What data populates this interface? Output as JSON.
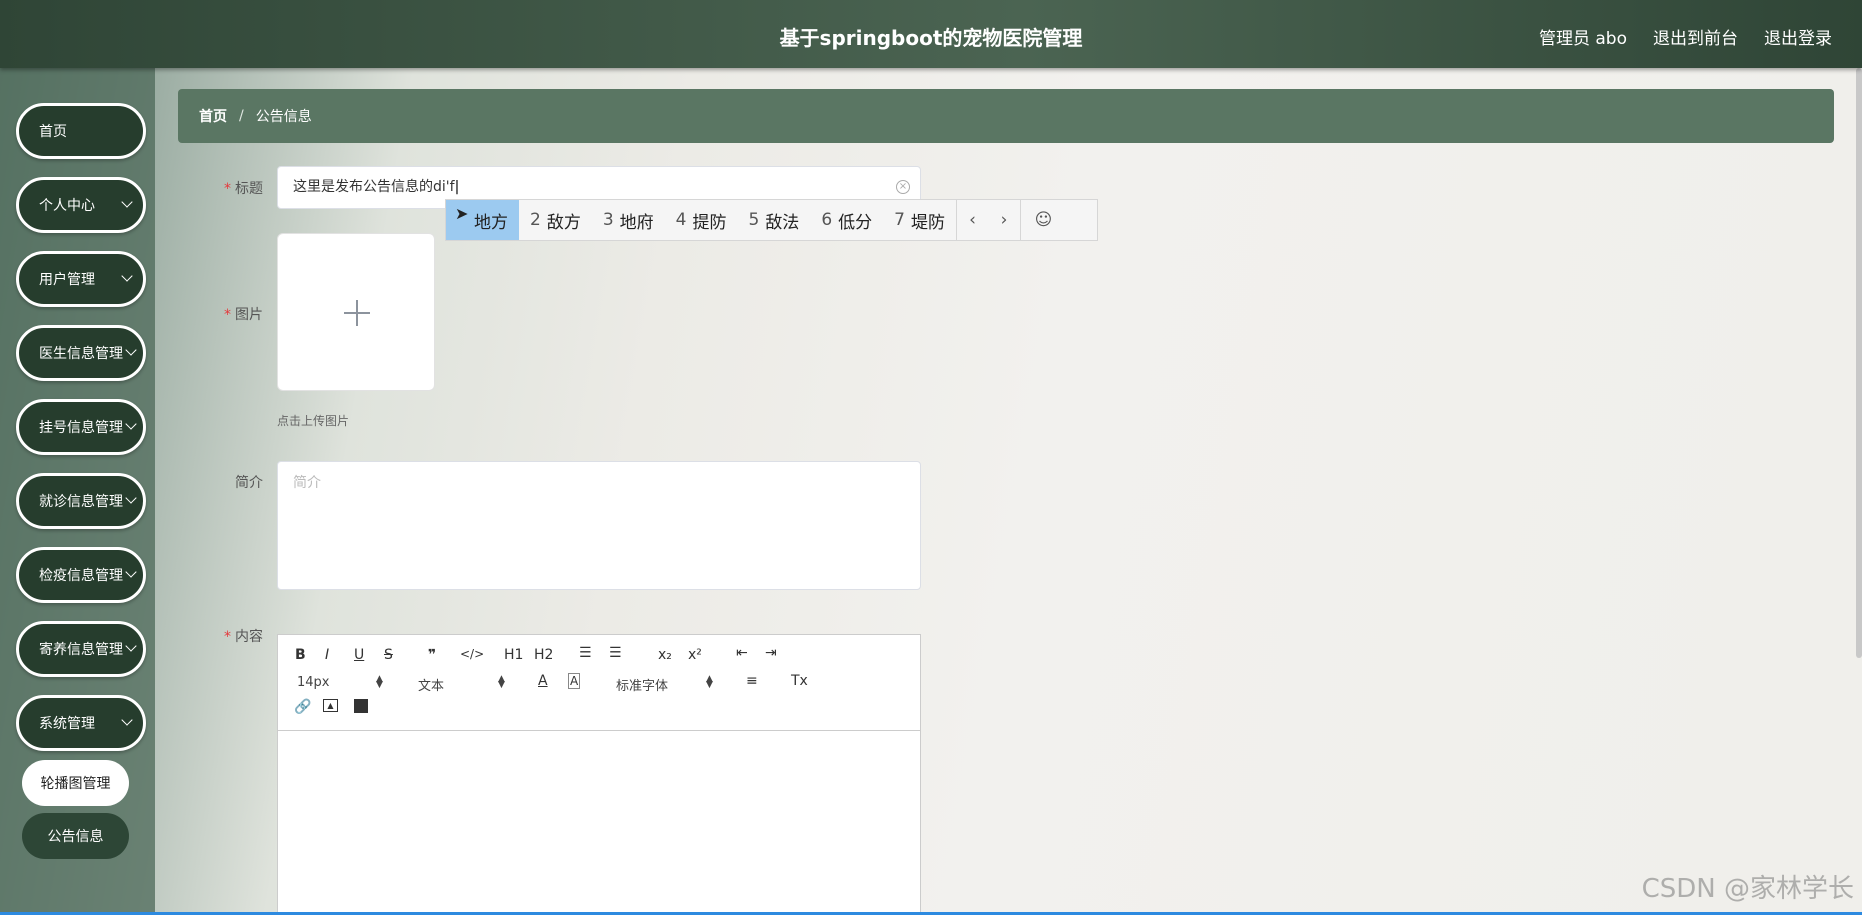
{
  "header": {
    "title": "基于springboot的宠物医院管理",
    "user_label": "管理员 abo",
    "to_front": "退出到前台",
    "logout": "退出登录"
  },
  "sidebar": {
    "items": [
      {
        "label": "首页",
        "chevron": false
      },
      {
        "label": "个人中心",
        "chevron": true
      },
      {
        "label": "用户管理",
        "chevron": true
      },
      {
        "label": "医生信息管理",
        "chevron": true
      },
      {
        "label": "挂号信息管理",
        "chevron": true
      },
      {
        "label": "就诊信息管理",
        "chevron": true
      },
      {
        "label": "检疫信息管理",
        "chevron": true
      },
      {
        "label": "寄养信息管理",
        "chevron": true
      },
      {
        "label": "系统管理",
        "chevron": true
      }
    ],
    "sub_items": [
      {
        "label": "轮播图管理"
      },
      {
        "label": "公告信息"
      }
    ]
  },
  "breadcrumb": {
    "home": "首页",
    "separator": "/",
    "current": "公告信息"
  },
  "form": {
    "required_mark": "*",
    "title_label": "标题",
    "title_value": "这里是发布公告信息的di'f",
    "image_label": "图片",
    "upload_tip": "点击上传图片",
    "intro_label": "简介",
    "intro_placeholder": "简介",
    "content_label": "内容"
  },
  "ime": {
    "candidates": [
      {
        "num": "1",
        "text": "地方"
      },
      {
        "num": "2",
        "text": "敌方"
      },
      {
        "num": "3",
        "text": "地府"
      },
      {
        "num": "4",
        "text": "提防"
      },
      {
        "num": "5",
        "text": "敌法"
      },
      {
        "num": "6",
        "text": "低分"
      },
      {
        "num": "7",
        "text": "堤防"
      }
    ],
    "prev": "‹",
    "next": "›",
    "emoji": "☺"
  },
  "editor": {
    "font_size": "14px",
    "header_select": "文本",
    "font_select": "标准字体",
    "bold": "B",
    "italic": "I",
    "underline": "U",
    "strike": "S",
    "quote": "❞",
    "code": "</>",
    "h1": "H1",
    "h2": "H2",
    "sub": "x₂",
    "sup": "x²",
    "font_color": "A",
    "clear": "Tx"
  },
  "watermark": "CSDN @家林学长"
}
